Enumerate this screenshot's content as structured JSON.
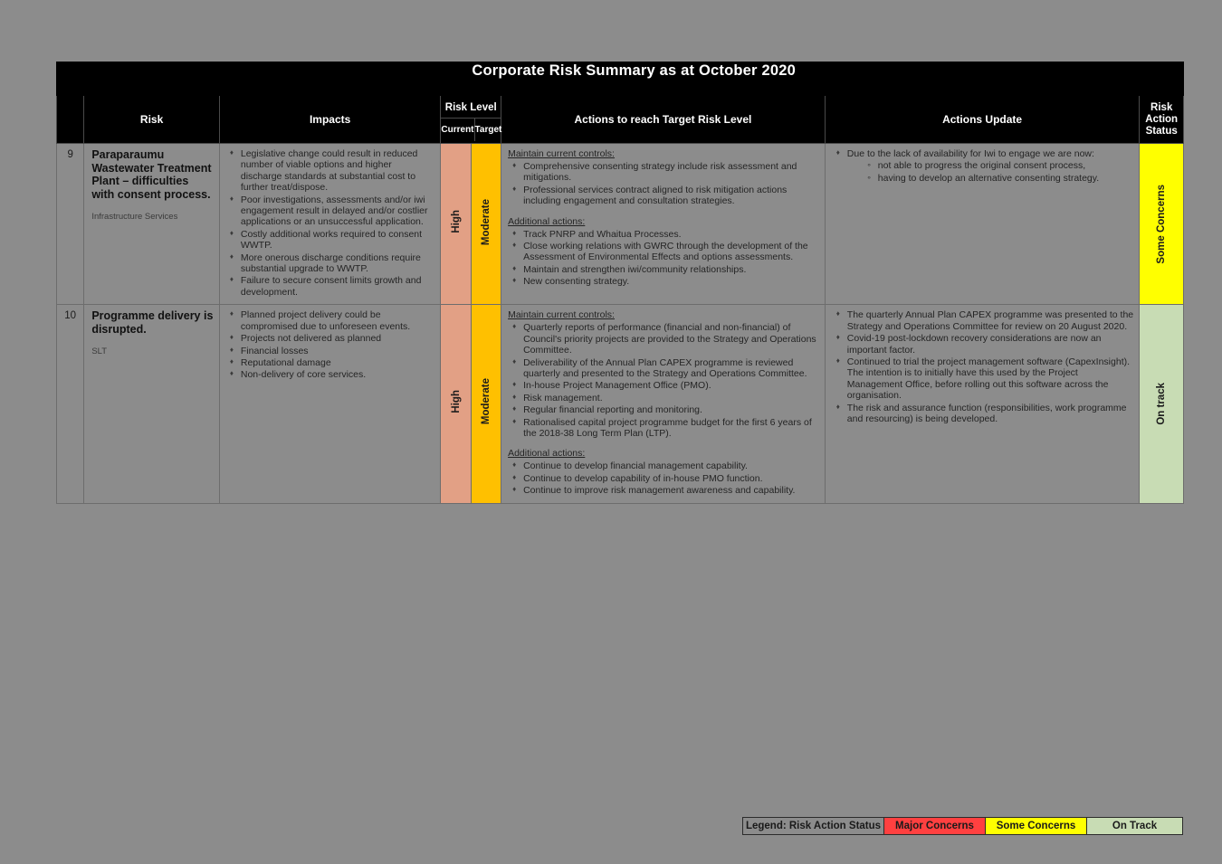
{
  "document": {
    "title": "Corporate Risk Summary as at October 2020"
  },
  "colors": {
    "high": "#e2a085",
    "moderate": "#ffc000",
    "some_concerns": "#ffff00",
    "on_track": "#c8dcb4",
    "major_concerns": "#ff4040",
    "header_bg": "#000000",
    "page_bg": "#8c8c8c"
  },
  "table": {
    "headers": {
      "number": "",
      "risk": "Risk",
      "impacts": "Impacts",
      "risk_level": "Risk Level",
      "risk_level_current": "Current",
      "risk_level_target": "Target",
      "actions": "Actions to reach Target Risk Level",
      "actions_update": "Actions Update",
      "risk_action_status": "Risk Action Status"
    },
    "rows": [
      {
        "number": "9",
        "risk_title": "Paraparaumu Wastewater Treatment Plant – difficulties with consent process.",
        "risk_owner": "Infrastructure Services",
        "impacts": [
          "Legislative change could result in reduced number of viable options and higher discharge standards at substantial cost to further treat/dispose.",
          "Poor investigations, assessments and/or iwi engagement result in delayed and/or costlier applications or an unsuccessful application.",
          "Costly additional works required to consent WWTP.",
          "More onerous discharge conditions require substantial upgrade to WWTP.",
          "Failure to secure consent limits growth and development."
        ],
        "level_current": "High",
        "level_target": "Moderate",
        "actions": {
          "maintain_heading": "Maintain current controls:",
          "maintain_items": [
            "Comprehensive consenting strategy include risk assessment and mitigations.",
            "Professional services contract aligned to risk mitigation actions including engagement and consultation strategies."
          ],
          "additional_heading": "Additional actions:",
          "additional_items": [
            "Track PNRP and Whaitua Processes.",
            "Close working relations with GWRC through the development of the Assessment of Environmental Effects and options assessments.",
            "Maintain and strengthen iwi/community relationships.",
            "New consenting strategy."
          ]
        },
        "updates": [
          {
            "text": "Due to the lack of availability for Iwi to engage we are now:",
            "subitems": [
              "not able to progress the original consent process,",
              "having to develop an alternative consenting strategy."
            ]
          }
        ],
        "status": "Some Concerns",
        "status_color": "#ffff00"
      },
      {
        "number": "10",
        "risk_title": "Programme delivery is disrupted.",
        "risk_owner": "SLT",
        "impacts": [
          "Planned project delivery could be compromised due to unforeseen events.",
          "Projects not delivered as planned",
          "Financial losses",
          "Reputational damage",
          "Non-delivery of core services."
        ],
        "level_current": "High",
        "level_target": "Moderate",
        "actions": {
          "maintain_heading": "Maintain current controls:",
          "maintain_items": [
            "Quarterly reports of performance (financial and non-financial) of Council's priority projects are provided to the Strategy and Operations Committee.",
            "Deliverability of the Annual Plan CAPEX programme is reviewed quarterly and presented to the Strategy and Operations Committee.",
            "In-house Project Management Office (PMO).",
            "Risk management.",
            "Regular financial reporting and monitoring.",
            "Rationalised capital project programme budget for the first 6 years of the 2018-38 Long Term Plan (LTP)."
          ],
          "additional_heading": "Additional actions:",
          "additional_items": [
            "Continue to develop financial management capability.",
            "Continue to develop capability of in-house PMO function.",
            "Continue to improve risk management awareness and capability."
          ]
        },
        "updates": [
          {
            "text": "The quarterly Annual Plan CAPEX programme was presented to the Strategy and Operations Committee for review on 20 August 2020.",
            "subitems": []
          },
          {
            "text": "Covid-19 post-lockdown recovery considerations are now an important factor.",
            "subitems": []
          },
          {
            "text": "Continued to trial the project management software (CapexInsight).  The intention is to initially have this used by the Project Management Office, before rolling out this software across the organisation.",
            "subitems": []
          },
          {
            "text": "The risk and assurance function (responsibilities, work programme and resourcing) is being developed.",
            "subitems": []
          }
        ],
        "status": "On track",
        "status_color": "#c8dcb4"
      }
    ]
  },
  "legend": {
    "label": "Legend: Risk Action Status",
    "major": "Major Concerns",
    "some": "Some Concerns",
    "ontrack": "On Track"
  }
}
